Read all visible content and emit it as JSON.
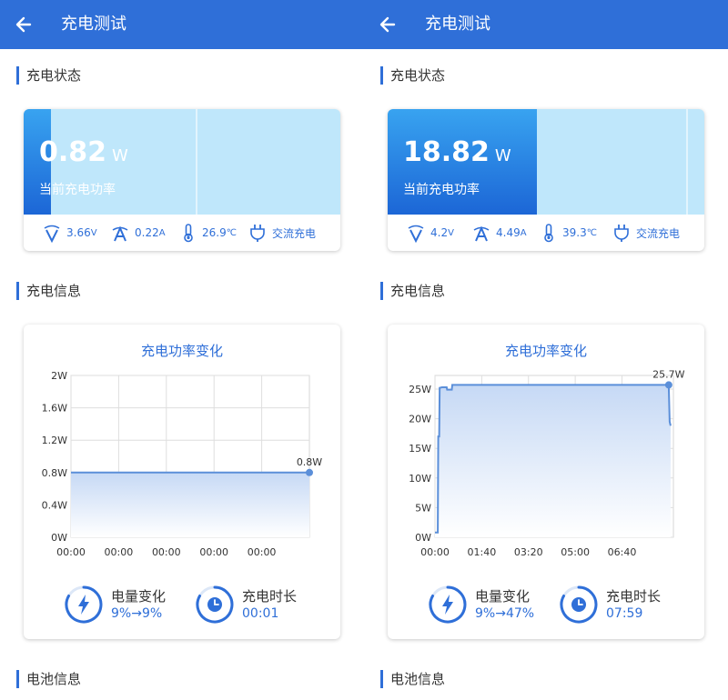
{
  "colors": {
    "primary": "#2f6fd8",
    "light_fill": "#bfe7fb",
    "line": "#5b8fd9"
  },
  "panels": [
    {
      "header": {
        "title": "充电测试",
        "back_icon": "arrow-left-icon"
      },
      "charging_status": {
        "section_title": "充电状态",
        "power_value": "0.82",
        "power_unit": "W",
        "power_label": "当前充电功率",
        "power_fill_fraction": 0.085,
        "voltage": "3.66",
        "voltage_unit": "V",
        "current": "0.22",
        "current_unit": "A",
        "temperature": "26.9",
        "temperature_unit": "℃",
        "charge_type": "交流充电"
      },
      "charging_info": {
        "section_title": "充电信息",
        "chart_data": {
          "type": "line",
          "title": "充电功率变化",
          "y_ticks": [
            "2W",
            "1.6W",
            "1.2W",
            "0.8W",
            "0.4W",
            "0W"
          ],
          "ylim": [
            0,
            2
          ],
          "x_ticks": [
            "00:00",
            "00:00",
            "00:00",
            "00:00",
            "00:00"
          ],
          "xlim": [
            0,
            5
          ],
          "points": [
            [
              0,
              0.8
            ],
            [
              5,
              0.8
            ]
          ],
          "end_label": "0.8W",
          "grid": true
        },
        "battery_change_label": "电量变化",
        "battery_change_value": "9%→9%",
        "duration_label": "充电时长",
        "duration_value": "00:01"
      },
      "battery_info": {
        "section_title": "电池信息"
      }
    },
    {
      "header": {
        "title": "充电测试",
        "back_icon": "arrow-left-icon"
      },
      "charging_status": {
        "section_title": "充电状态",
        "power_value": "18.82",
        "power_unit": "W",
        "power_label": "当前充电功率",
        "power_fill_fraction": 0.47,
        "voltage": "4.2",
        "voltage_unit": "V",
        "current": "4.49",
        "current_unit": "A",
        "temperature": "39.3",
        "temperature_unit": "℃",
        "charge_type": "交流充电"
      },
      "charging_info": {
        "section_title": "充电信息",
        "chart_data": {
          "type": "area",
          "title": "充电功率变化",
          "y_ticks": [
            "25W",
            "20W",
            "15W",
            "10W",
            "5W",
            "0W"
          ],
          "ylim": [
            0,
            27.3
          ],
          "x_ticks": [
            "00:00",
            "01:40",
            "03:20",
            "05:00",
            "06:40"
          ],
          "xlim": [
            0,
            510
          ],
          "points": [
            [
              0,
              0.8
            ],
            [
              6,
              0.8
            ],
            [
              7,
              17
            ],
            [
              9,
              17
            ],
            [
              10,
              25.2
            ],
            [
              15,
              25.3
            ],
            [
              25,
              25.3
            ],
            [
              26,
              24.9
            ],
            [
              36,
              24.9
            ],
            [
              37,
              25.7
            ],
            [
              500,
              25.7
            ],
            [
              502,
              19.5
            ],
            [
              504,
              18.82
            ]
          ],
          "end_label": "25.7W",
          "grid": true
        },
        "battery_change_label": "电量变化",
        "battery_change_value": "9%→47%",
        "duration_label": "充电时长",
        "duration_value": "07:59"
      },
      "battery_info": {
        "section_title": "电池信息"
      }
    }
  ]
}
